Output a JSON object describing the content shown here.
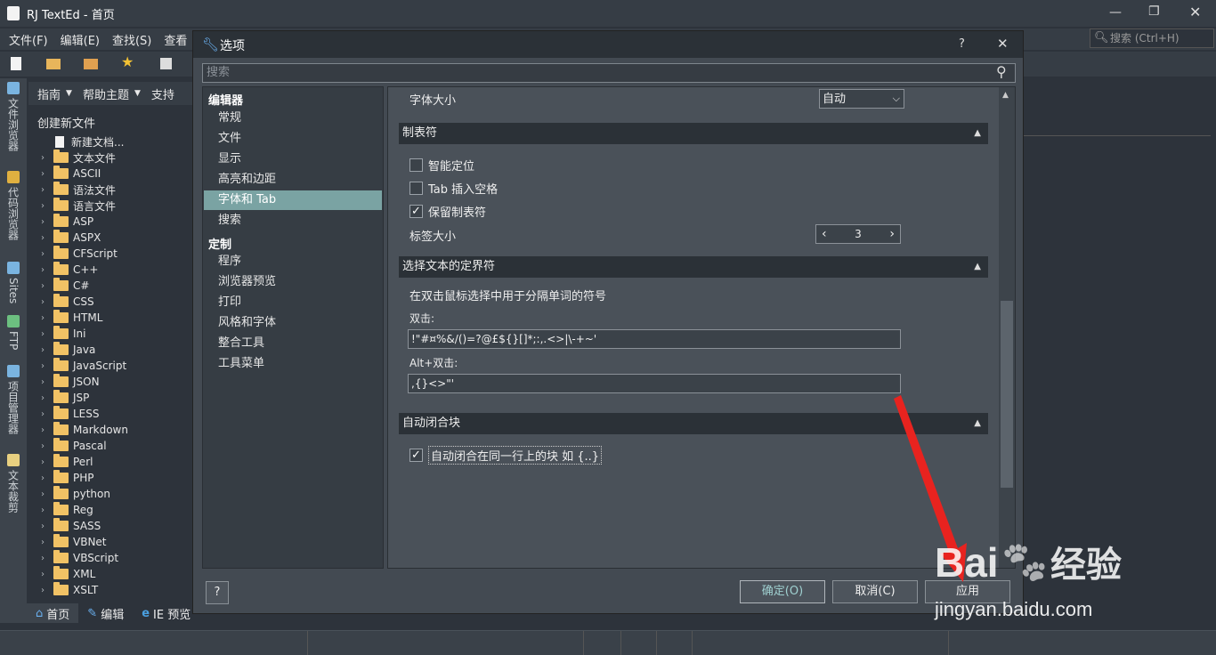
{
  "app": {
    "title": "RJ TextEd - 首页",
    "menu": [
      "文件(F)",
      "编辑(E)",
      "查找(S)",
      "查看"
    ],
    "search_placeholder": "搜索 (Ctrl+H)",
    "side_tabs": [
      "文件浏览器",
      "代码浏览器",
      "Sites",
      "FTP",
      "项目管理器",
      "文本裁剪"
    ],
    "panel_header": [
      "指南",
      "帮助主题",
      "支持"
    ],
    "tree_title": "创建新文件",
    "tree_new_doc": "新建文档...",
    "tree_items": [
      "文本文件",
      "ASCII",
      "语法文件",
      "语言文件",
      "ASP",
      "ASPX",
      "CFScript",
      "C++",
      "C#",
      "CSS",
      "HTML",
      "Ini",
      "Java",
      "JavaScript",
      "JSON",
      "JSP",
      "LESS",
      "Markdown",
      "Pascal",
      "Perl",
      "PHP",
      "python",
      "Reg",
      "SASS",
      "VBNet",
      "VBScript",
      "XML",
      "XSLT"
    ],
    "bottom_tabs": [
      "首页",
      "编辑",
      "IE 预览"
    ]
  },
  "dialog": {
    "title": "选项",
    "help": "?",
    "close": "✕",
    "search_placeholder": "搜索",
    "nav": {
      "group1": "编辑器",
      "group1_items": [
        "常规",
        "文件",
        "显示",
        "高亮和边距",
        "字体和 Tab",
        "搜索"
      ],
      "group2": "定制",
      "group2_items": [
        "程序",
        "浏览器预览",
        "打印",
        "风格和字体",
        "整合工具",
        "工具菜单"
      ]
    },
    "content": {
      "font_size_label": "字体大小",
      "font_size_value": "自动",
      "tab_section": "制表符",
      "cb_smart": "智能定位",
      "cb_smart_checked": false,
      "cb_tab_spaces": "Tab 插入空格",
      "cb_tab_spaces_checked": false,
      "cb_keep_tabs": "保留制表符",
      "cb_keep_tabs_checked": true,
      "tab_size_label": "标签大小",
      "tab_size_value": "3",
      "delim_section": "选择文本的定界符",
      "delim_desc": "在双击鼠标选择中用于分隔单词的符号",
      "dbl_label": "双击:",
      "dbl_value": "!\"#¤%&/()=?@£${}[]*;:,.<>|\\-+~'",
      "alt_label": "Alt+双击:",
      "alt_value": ",{}<>\"'",
      "auto_section": "自动闭合块",
      "cb_auto": "自动闭合在同一行上的块 如 {..}",
      "cb_auto_checked": true
    },
    "buttons": {
      "help": "?",
      "ok": "确定(O)",
      "cancel": "取消(C)",
      "apply": "应用"
    }
  },
  "colors": {
    "selected_nav": "#7aa3a3",
    "arrow": "#e8231f"
  },
  "watermark": "jingyan.baidu.com"
}
